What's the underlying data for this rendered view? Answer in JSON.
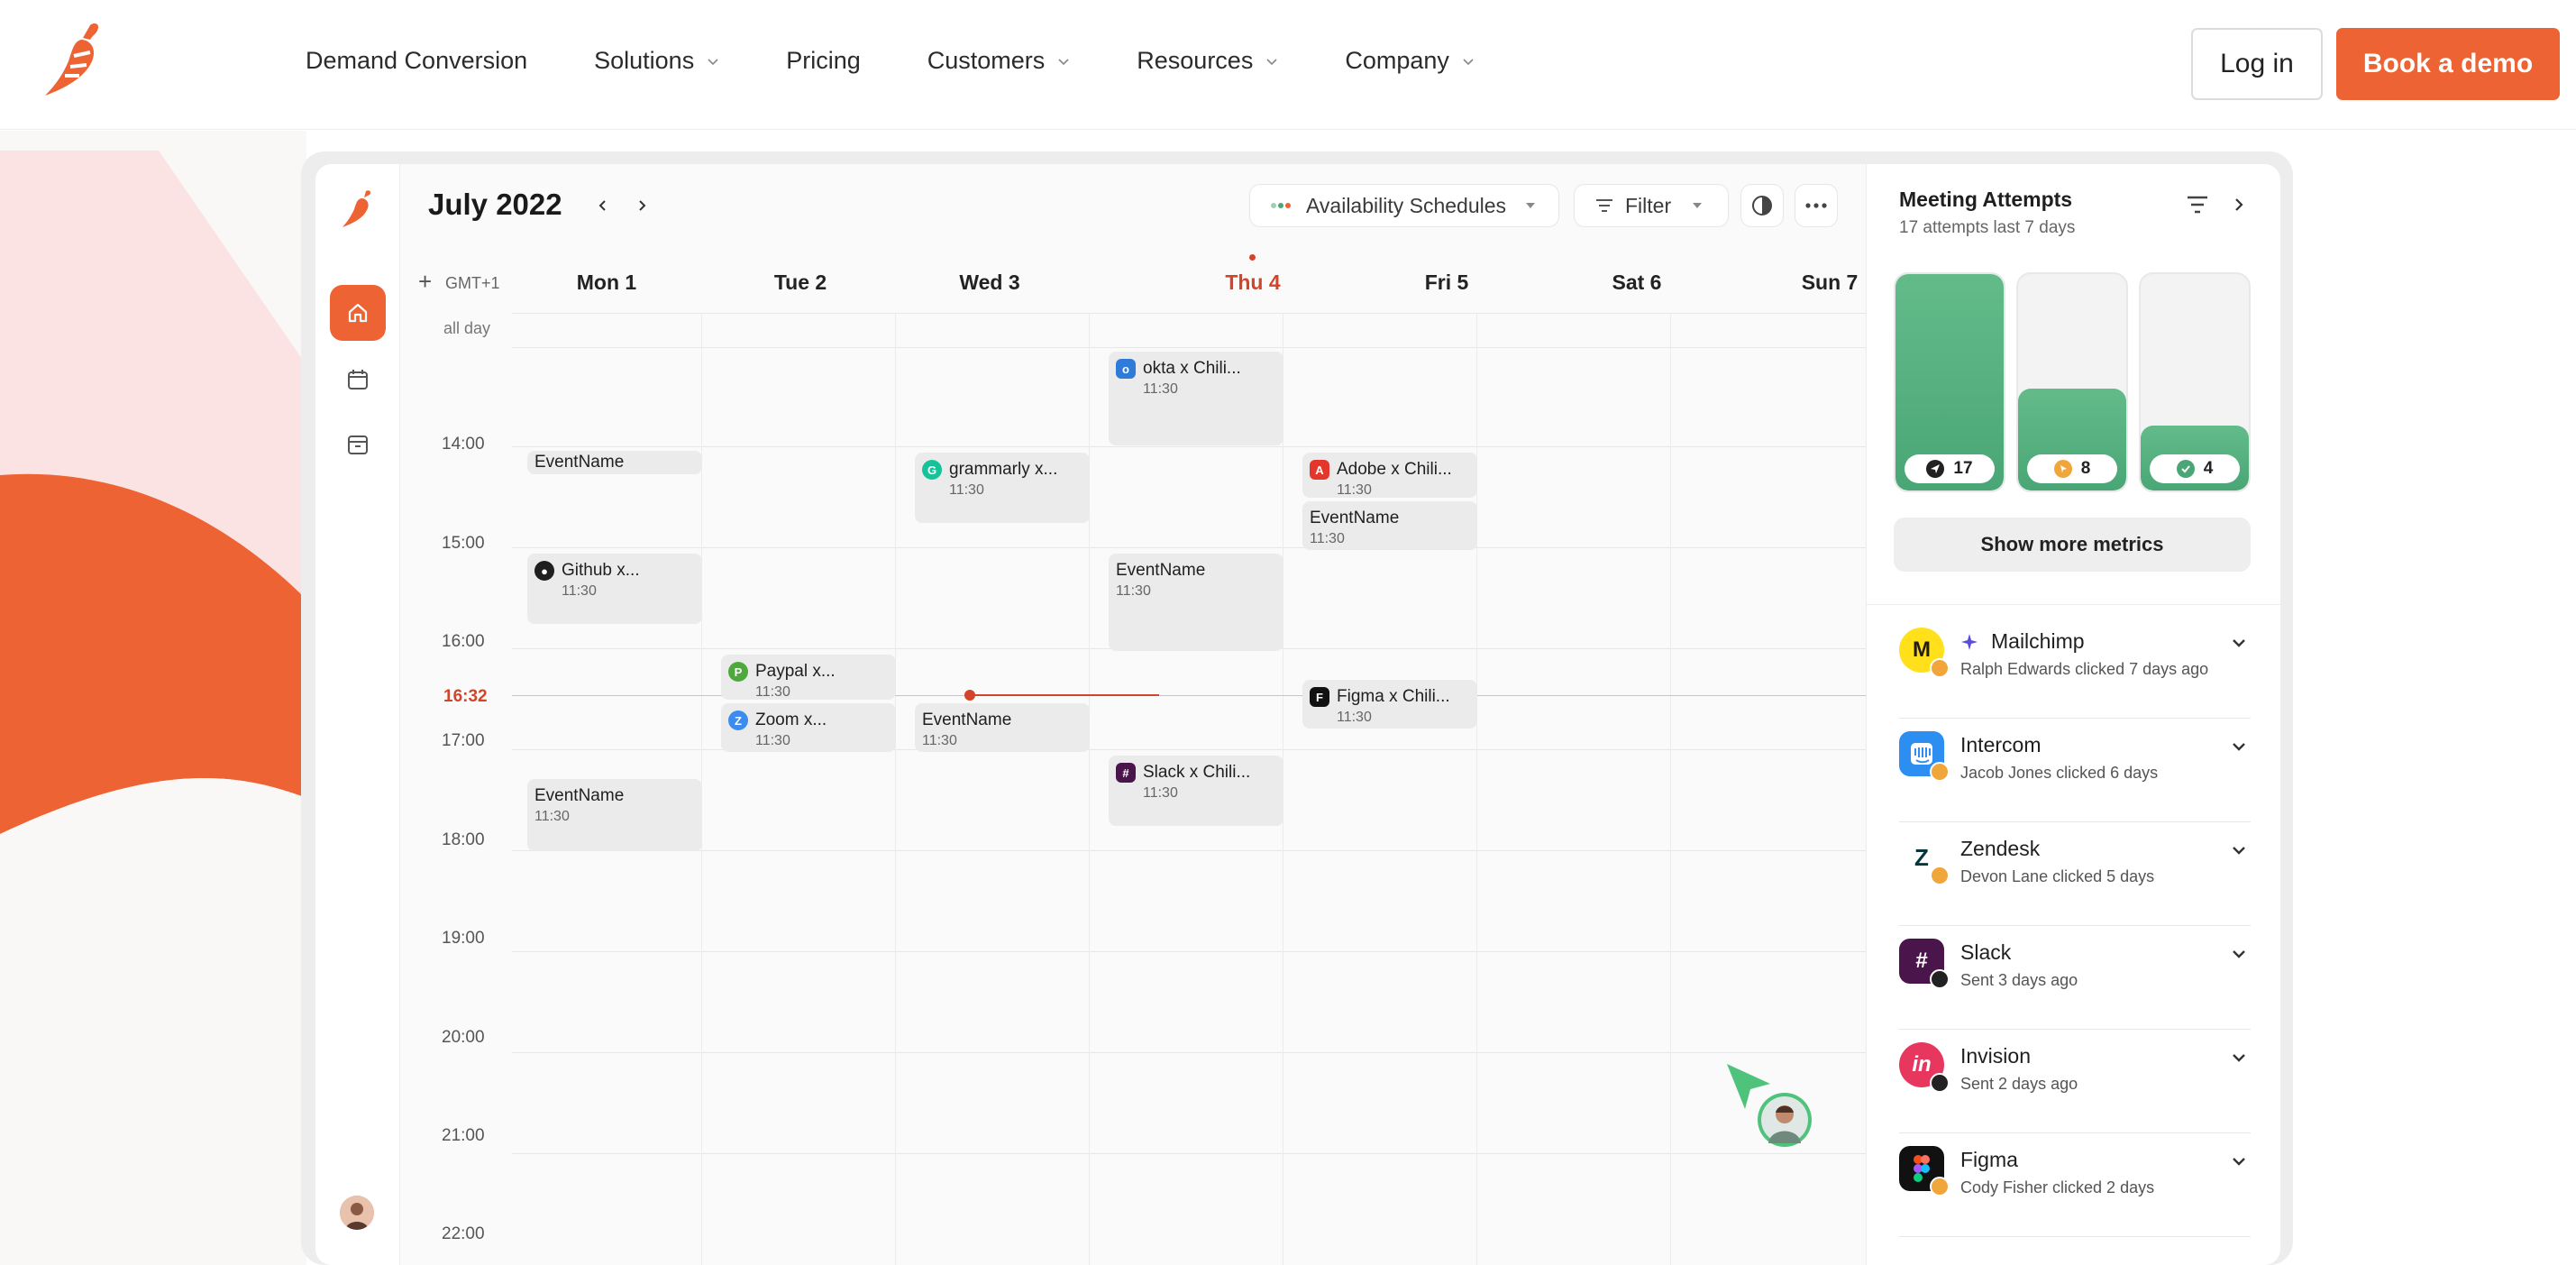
{
  "nav": {
    "links": [
      {
        "label": "Demand Conversion",
        "dropdown": false
      },
      {
        "label": "Solutions",
        "dropdown": true
      },
      {
        "label": "Pricing",
        "dropdown": false
      },
      {
        "label": "Customers",
        "dropdown": true
      },
      {
        "label": "Resources",
        "dropdown": true
      },
      {
        "label": "Company",
        "dropdown": true
      }
    ],
    "login": "Log in",
    "demo": "Book a demo"
  },
  "colors": {
    "brand": "#ee6333",
    "today": "#d2452b",
    "metric": "#4aa676"
  },
  "calendar": {
    "title": "July 2022",
    "availability": "Availability Schedules",
    "filter": "Filter",
    "timezone": "GMT+1",
    "all_day": "all day",
    "days": [
      "Mon 1",
      "Tue 2",
      "Wed 3",
      "Thu 4",
      "Fri 5",
      "Sat 6",
      "Sun 7"
    ],
    "today_index": 3,
    "hours": [
      "14:00",
      "15:00",
      "16:00",
      "17:00",
      "18:00",
      "19:00",
      "20:00",
      "21:00",
      "22:00"
    ],
    "now": "16:32",
    "events": {
      "okta": {
        "title": "okta x Chili...",
        "time": "11:30",
        "icon": "okta-icon"
      },
      "mon_event": {
        "title": "EventName"
      },
      "grammarly": {
        "title": "grammarly x...",
        "time": "11:30",
        "icon": "grammarly-icon"
      },
      "adobe": {
        "title": "Adobe x Chili...",
        "time": "11:30",
        "icon": "adobe-icon"
      },
      "fri_event": {
        "title": "EventName",
        "time": "11:30"
      },
      "github": {
        "title": "Github x...",
        "time": "11:30",
        "icon": "github-icon"
      },
      "thu_event": {
        "title": "EventName",
        "time": "11:30"
      },
      "paypal": {
        "title": "Paypal x...",
        "time": "11:30",
        "icon": "paypal-icon"
      },
      "figma": {
        "title": "Figma x Chili...",
        "time": "11:30",
        "icon": "figma-icon"
      },
      "zoom": {
        "title": "Zoom x...",
        "time": "11:30",
        "icon": "zoom-icon"
      },
      "wed_event": {
        "title": "EventName",
        "time": "11:30"
      },
      "slack": {
        "title": "Slack x Chili...",
        "time": "11:30",
        "icon": "slack-icon"
      },
      "mon_event2": {
        "title": "EventName",
        "time": "11:30"
      }
    }
  },
  "panel": {
    "title": "Meeting Attempts",
    "subtitle": "17 attempts last 7 days",
    "metrics": [
      {
        "value": "17",
        "fill": 1.0,
        "icon": "send-icon"
      },
      {
        "value": "8",
        "fill": 0.47,
        "icon": "clicked-icon"
      },
      {
        "value": "4",
        "fill": 0.3,
        "icon": "check-icon"
      }
    ],
    "more_metrics": "Show more metrics",
    "items": [
      {
        "name": "Mailchimp",
        "status": "Ralph Edwards clicked 7 days ago",
        "icon": "mailchimp-icon"
      },
      {
        "name": "Intercom",
        "status": "Jacob Jones clicked 6 days",
        "icon": "intercom-icon"
      },
      {
        "name": "Zendesk",
        "status": "Devon Lane clicked 5 days",
        "icon": "zendesk-icon"
      },
      {
        "name": "Slack",
        "status": "Sent 3 days ago",
        "icon": "slack-icon"
      },
      {
        "name": "Invision",
        "status": "Sent 2 days ago",
        "icon": "invision-icon"
      },
      {
        "name": "Figma",
        "status": "Cody Fisher clicked 2 days",
        "icon": "figma-icon"
      }
    ]
  }
}
